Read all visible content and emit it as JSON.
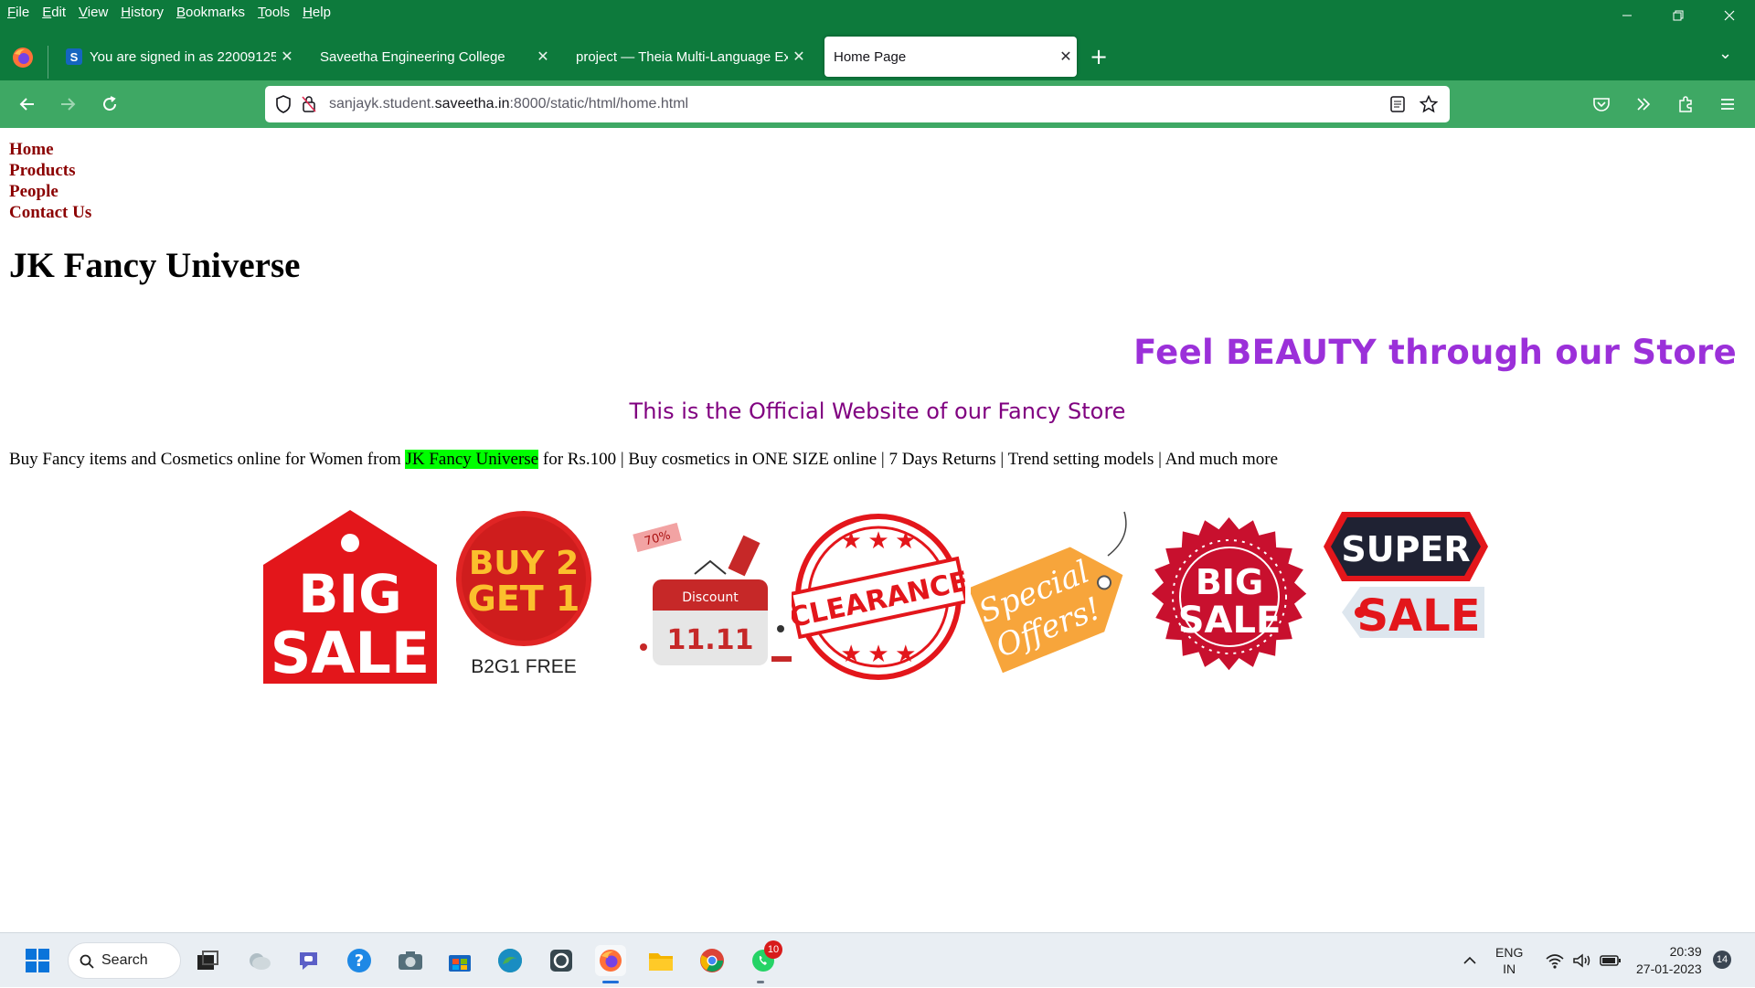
{
  "browser": {
    "menu": [
      "File",
      "Edit",
      "View",
      "History",
      "Bookmarks",
      "Tools",
      "Help"
    ],
    "tabs": [
      {
        "title": "You are signed in as 22009125",
        "favicon": "S"
      },
      {
        "title": "Saveetha Engineering College"
      },
      {
        "title": "project — Theia Multi-Language Ex"
      },
      {
        "title": "Home Page",
        "active": true
      }
    ],
    "url": {
      "prefix": "sanjayk.student.",
      "host": "saveetha.in",
      "suffix": ":8000/static/html/home.html"
    },
    "colors": {
      "tabstrip": "#0d7a3c",
      "navbar": "#3ea864"
    }
  },
  "page": {
    "nav_links": [
      "Home",
      "Products",
      "People",
      "Contact Us"
    ],
    "store_title": "JK Fancy Universe",
    "tagline": "Feel BEAUTY through our Store",
    "subtitle": "This is the Official Website of our Fancy Store",
    "promo": {
      "before": "Buy Fancy items and Cosmetics online for Women from ",
      "highlight": "JK Fancy Universe",
      "after": " for Rs.100 | Buy cosmetics in ONE SIZE online | 7 Days Returns | Trend setting models | And much more"
    },
    "badges": {
      "big_sale_tag": [
        "BIG",
        "SALE"
      ],
      "buy2get1": [
        "BUY 2",
        "GET 1",
        "B2G1 FREE"
      ],
      "discount_calendar": [
        "Discount",
        "11.11",
        "70%"
      ],
      "clearance": "CLEARANCE",
      "special_offers": [
        "Special",
        "Offers!"
      ],
      "big_sale_seal": [
        "BIG",
        "SALE"
      ],
      "super_sale": [
        "SUPER",
        "SALE"
      ]
    },
    "colors": {
      "nav_link": "#8b0000",
      "tagline": "#9b30d9",
      "subtitle": "#800080",
      "highlight": "#00ff00"
    }
  },
  "taskbar": {
    "search_label": "Search",
    "language": [
      "ENG",
      "IN"
    ],
    "time": "20:39",
    "date": "27-01-2023",
    "notification_count": "14",
    "whatsapp_badge": "10"
  }
}
